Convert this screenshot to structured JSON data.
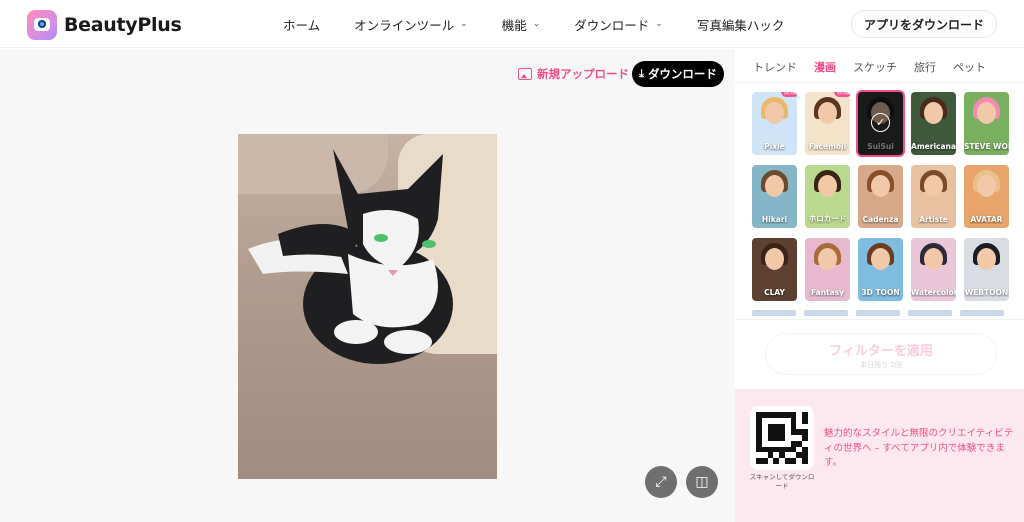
{
  "header": {
    "brand": "BeautyPlus",
    "nav": [
      {
        "label": "ホーム",
        "dropdown": false
      },
      {
        "label": "オンラインツール",
        "dropdown": true
      },
      {
        "label": "機能",
        "dropdown": true
      },
      {
        "label": "ダウンロード",
        "dropdown": true
      },
      {
        "label": "写真編集ハック",
        "dropdown": false
      }
    ],
    "app_download_label": "アプリをダウンロード"
  },
  "workspace": {
    "new_upload_label": "新規アップロード",
    "download_label": "ダウンロード",
    "icons": {
      "new_upload": "image-icon",
      "download": "download-icon",
      "expand": "expand-icon",
      "compare": "compare-icon"
    }
  },
  "panel": {
    "tabs": [
      "トレンド",
      "漫画",
      "スケッチ",
      "旅行",
      "ペット"
    ],
    "active_tab": "漫画",
    "styles": [
      {
        "label": "Pixie",
        "badge": "新規",
        "bg": "#cfe4f6",
        "hair": "#e9b86a"
      },
      {
        "label": "Facemoji",
        "badge": "新規",
        "bg": "#f4e3c9",
        "hair": "#5a3620"
      },
      {
        "label": "SuiSui",
        "badge": "",
        "bg": "#3b3b3b",
        "hair": "#222222",
        "selected": true
      },
      {
        "label": "Americana",
        "badge": "",
        "bg": "#3f5a3a",
        "hair": "#4a2a18"
      },
      {
        "label": "STEVE WORLD",
        "badge": "",
        "bg": "#79b060",
        "hair": "#f28bb0"
      },
      {
        "label": "Hikari",
        "badge": "",
        "bg": "#86b7c9",
        "hair": "#6b4a2e"
      },
      {
        "label": "ホロカード",
        "badge": "",
        "bg": "#b8d98e",
        "hair": "#3a2416"
      },
      {
        "label": "Cadenza",
        "badge": "",
        "bg": "#d7a98a",
        "hair": "#8a4f2a"
      },
      {
        "label": "Artiste",
        "badge": "",
        "bg": "#e7c1a0",
        "hair": "#7a4a2c"
      },
      {
        "label": "AVATAR",
        "badge": "",
        "bg": "#e9a46a",
        "hair": "#e7c08a"
      },
      {
        "label": "CLAY",
        "badge": "",
        "bg": "#5c4030",
        "hair": "#3a2418"
      },
      {
        "label": "Fantasy",
        "badge": "",
        "bg": "#e6b9cf",
        "hair": "#a86b3a"
      },
      {
        "label": "3D TOON",
        "badge": "",
        "bg": "#7fbde0",
        "hair": "#6b3d1e"
      },
      {
        "label": "Watercolor",
        "badge": "",
        "bg": "#e9c6d8",
        "hair": "#2e2a3a"
      },
      {
        "label": "WEBTOON",
        "badge": "",
        "bg": "#d9dde3",
        "hair": "#1c1c22"
      }
    ],
    "apply_label": "フィルターを適用",
    "apply_sub": "本日残り 2回"
  },
  "promo": {
    "qr_caption": "スキャンしてダウンロード",
    "text": "魅力的なスタイルと無限のクリエイティビティの世界へ – すべてアプリ内で体験できます。"
  },
  "colors": {
    "accent": "#f2508c",
    "workspace_bg": "#f7f7f8",
    "promo_bg": "#fde8ef"
  }
}
